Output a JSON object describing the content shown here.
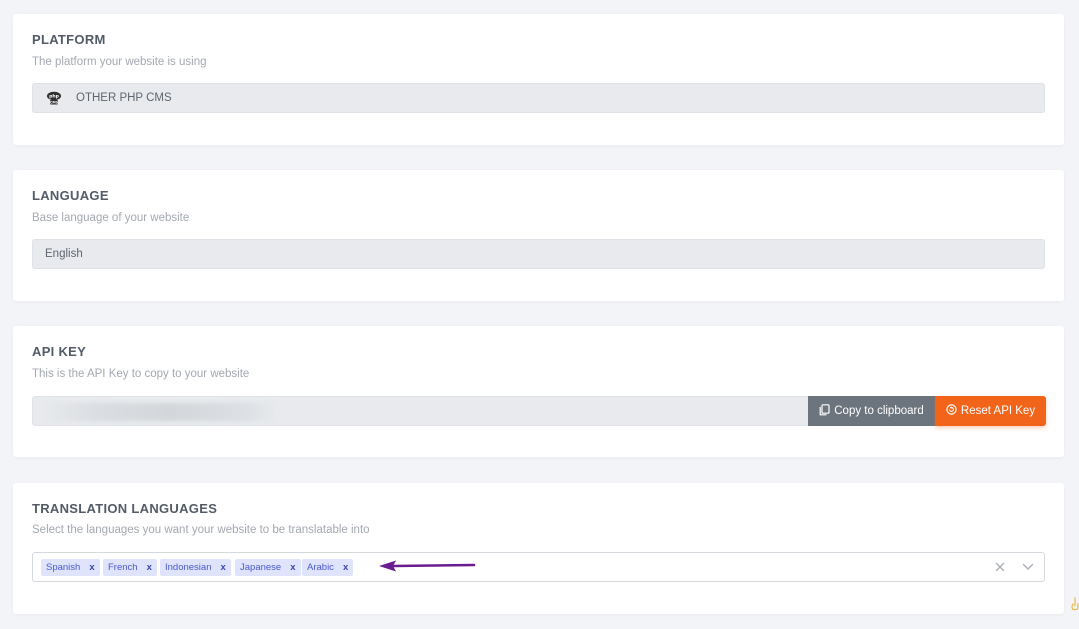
{
  "platform": {
    "title": "PLATFORM",
    "subtitle": "The platform your website is using",
    "value": "OTHER PHP CMS",
    "icon": "php-cms-icon"
  },
  "language": {
    "title": "LANGUAGE",
    "subtitle": "Base language of your website",
    "value": "English"
  },
  "api_key": {
    "title": "API KEY",
    "subtitle": "This is the API Key to copy to your website",
    "copy_label": "Copy to clipboard",
    "reset_label": "Reset API Key",
    "copy_color": "#6c757d",
    "reset_color": "#f26419"
  },
  "translation": {
    "title": "TRANSLATION LANGUAGES",
    "subtitle": "Select the languages you want your website to be translatable into",
    "tags": [
      "Spanish",
      "French",
      "Indonesian",
      "Japanese",
      "Arabic"
    ],
    "tag_remove_glyph": "x",
    "annotation_arrow_color": "#6a1b8f"
  }
}
